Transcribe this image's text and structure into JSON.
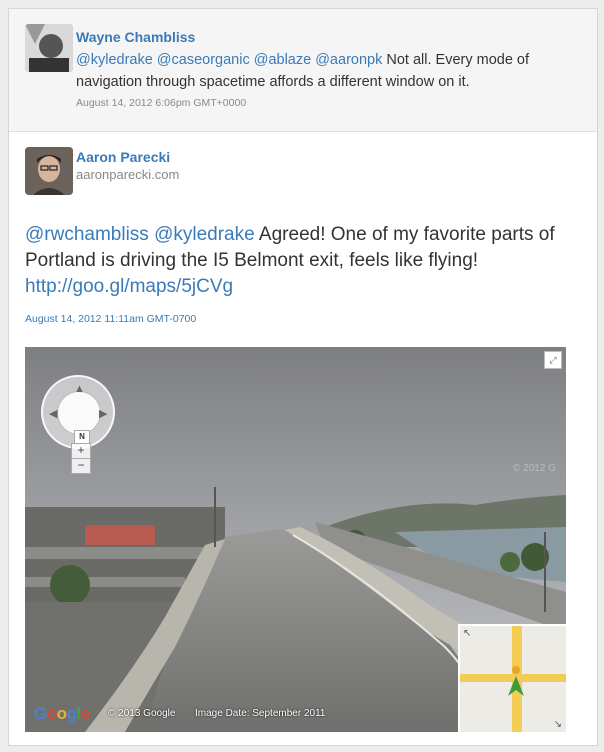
{
  "reply": {
    "author": "Wayne Chambliss",
    "mentions": "@kyledrake @caseorganic @ablaze @aaronpk",
    "text": " Not all. Every mode of navigation through spacetime affords a different window on it.",
    "date": "August 14, 2012 6:06pm GMT+0000"
  },
  "tweet": {
    "author": "Aaron Parecki",
    "site": "aaronparecki.com",
    "mentions": "@rwchambliss @kyledrake",
    "text": " Agreed! One of my favorite parts of Portland is driving the I5 Belmont exit, feels like flying! ",
    "link": "http://goo.gl/maps/5jCVg",
    "date": "August 14, 2012 11:11am GMT-0700"
  },
  "map": {
    "compass_label": "N",
    "zoom_in": "+",
    "zoom_out": "−",
    "logo": "Google",
    "copyright": "© 2013 Google",
    "image_date": "Image Date: September 2011",
    "watermark": "© 2012 G"
  },
  "colors": {
    "link": "#3a7ab8",
    "text": "#333333",
    "meta": "#8a8a8a"
  }
}
